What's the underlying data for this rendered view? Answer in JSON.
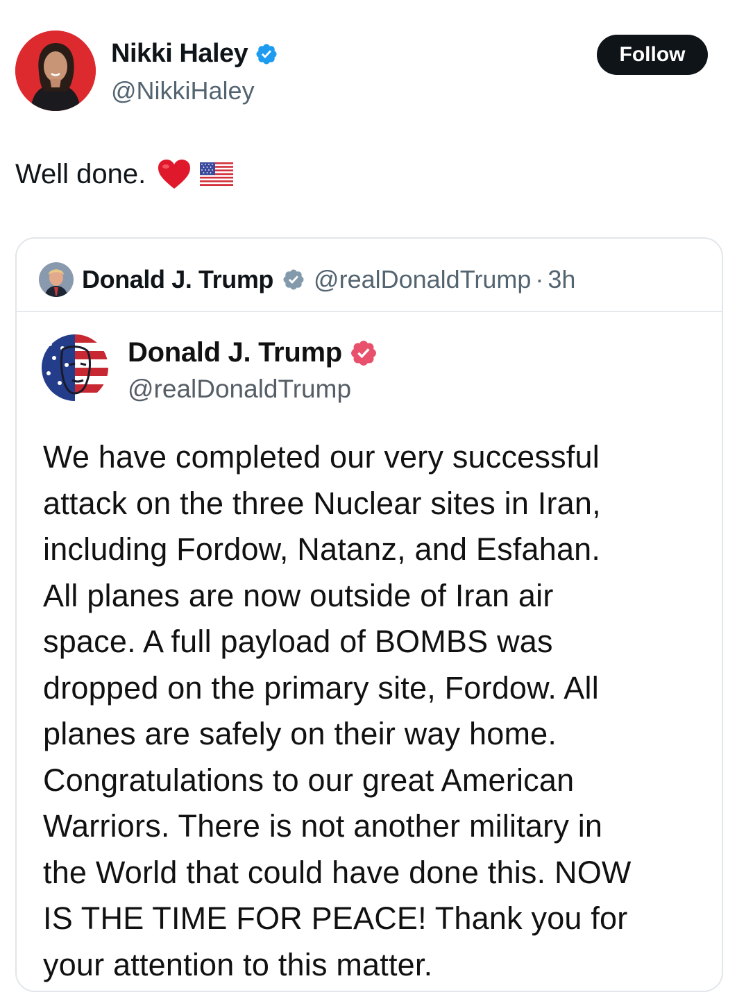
{
  "author": {
    "name": "Nikki Haley",
    "handle": "@NikkiHaley",
    "verified_icon": "verified-badge-icon",
    "follow_label": "Follow"
  },
  "tweet": {
    "text": "Well done.",
    "emoji": [
      "red-heart-icon",
      "us-flag-icon"
    ]
  },
  "quoted": {
    "name": "Donald J. Trump",
    "handle": "@realDonaldTrump",
    "separator": "·",
    "time": "3h",
    "verified_icon": "verified-badge-icon",
    "screenshot": {
      "name": "Donald J. Trump",
      "handle": "@realDonaldTrump",
      "badge_icon": "truth-verified-badge-icon",
      "lines": [
        "We have completed our very successful",
        "attack on the three Nuclear sites in Iran,",
        "including Fordow, Natanz, and Esfahan.",
        "All planes are now outside of Iran air",
        "space. A full payload of BOMBS was",
        "dropped on the primary site, Fordow. All",
        "planes are safely on their way home.",
        "Congratulations to our great American",
        "Warriors. There is not another military in",
        "the World that could have done this. NOW",
        "IS THE TIME FOR PEACE! Thank you for",
        "your attention to this matter."
      ]
    }
  },
  "colors": {
    "text": "#0f1419",
    "secondary": "#536471",
    "verified_blue": "#1d9bf0",
    "truth_badge": "#e8506b",
    "follow_bg": "#0f1419",
    "card_border": "#e2e6ea"
  }
}
